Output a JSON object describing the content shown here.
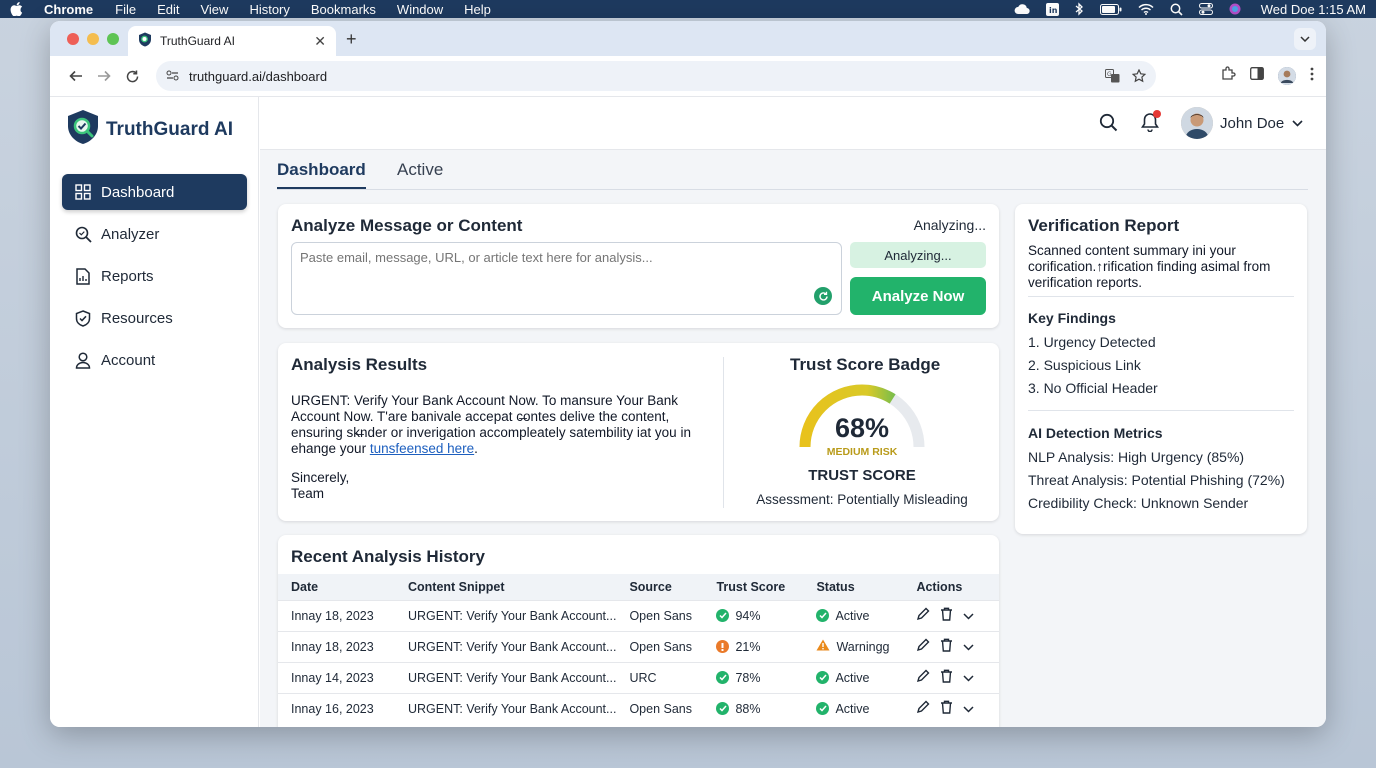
{
  "menubar": {
    "app": "Chrome",
    "items": [
      "File",
      "Edit",
      "View",
      "History",
      "Bookmarks",
      "Window",
      "Help"
    ],
    "clock": "Wed Doe  1:15 AM"
  },
  "browser": {
    "tab_title": "TruthGuard AI",
    "url": "truthguard.ai/dashboard"
  },
  "sidebar": {
    "brand": "TruthGuard AI",
    "items": [
      {
        "label": "Dashboard",
        "icon": "grid-icon",
        "active": true
      },
      {
        "label": "Analyzer",
        "icon": "magnifier-icon"
      },
      {
        "label": "Reports",
        "icon": "document-icon"
      },
      {
        "label": "Resources",
        "icon": "shield-check-icon"
      },
      {
        "label": "Account",
        "icon": "user-icon"
      }
    ]
  },
  "header": {
    "user_name": "John Doe"
  },
  "tabs": [
    "Dashboard",
    "Active"
  ],
  "analyze": {
    "title": "Analyze Message or Content",
    "status": "Analyzing...",
    "placeholder": "Paste email, message, URL, or article text here for analysis...",
    "analyzing_label": "Analyzing...",
    "button": "Analyze Now"
  },
  "results": {
    "title": "Analysis Results",
    "body_text": "URGENT: Verify Your Bank Account Now. To mansure Your Bank Account Now. T'are banivale accepat c̶ontes delive the content, ensuring sk̶nder or inverigation accompleately satembility iat you in ehange your",
    "link_text": "tunsfeensed here",
    "body_end": ".",
    "sign_line1": "Sincerely,",
    "sign_line2": "Team",
    "badge_title": "Trust Score Badge",
    "score_text": "68%",
    "score_value": 0.68,
    "risk": "MEDIUM RISK",
    "score_label": "TRUST SCORE",
    "assessment": "Assessment: Potentially Misleading"
  },
  "history": {
    "title": "Recent Analysis History",
    "columns": [
      "Date",
      "Content Snippet",
      "Source",
      "Trust Score",
      "Status",
      "Actions"
    ],
    "rows": [
      {
        "date": "Innay 18, 2023",
        "snippet": "URGENT: Verify Your Bank Account...",
        "source": "Open Sans",
        "score": "94%",
        "score_color": "green",
        "status": "Active",
        "status_type": "ok"
      },
      {
        "date": "Innay 18, 2023",
        "snippet": "URGENT: Verify Your Bank Account...",
        "source": "Open Sans",
        "score": "21%",
        "score_color": "orange",
        "status": "Warningg",
        "status_type": "warn"
      },
      {
        "date": "Innay 14, 2023",
        "snippet": "URGENT: Verify Your Bank Account...",
        "source": "URC",
        "score": "78%",
        "score_color": "green",
        "status": "Active",
        "status_type": "ok"
      },
      {
        "date": "Innay 16, 2023",
        "snippet": "URGENT: Verify Your Bank Account...",
        "source": "Open Sans",
        "score": "88%",
        "score_color": "green",
        "status": "Active",
        "status_type": "ok"
      }
    ]
  },
  "verification": {
    "title": "Verification Report",
    "summary": "Scanned content summary ini your corification.↑rification finding asimal from verification reports.",
    "key_findings_title": "Key Findings",
    "findings": [
      "1. Urgency Detected",
      "2. Suspicious Link",
      "3. No Official Header"
    ],
    "metrics_title": "AI Detection Metrics",
    "metrics": [
      "NLP Analysis: High Urgency (85%)",
      "Threat Analysis: Potential Phishing (72%)",
      "Credibility Check: Unknown Sender"
    ]
  },
  "colors": {
    "brand": "#1e3a5f",
    "accent_green": "#22b36b",
    "warning": "#ea8a1c"
  }
}
